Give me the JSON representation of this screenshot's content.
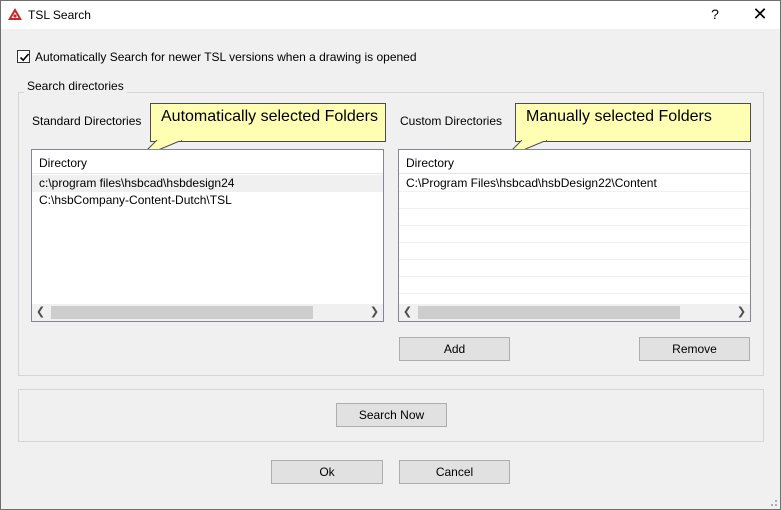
{
  "window": {
    "title": "TSL Search",
    "help_label": "?",
    "close_label": "✕",
    "app_icon": "hsbcad-logo-icon"
  },
  "auto_search": {
    "checked": true,
    "label": "Automatically Search for newer TSL versions when a drawing is opened"
  },
  "search_directories": {
    "group_title": "Search directories",
    "standard": {
      "label": "Standard Directories",
      "callout": "Automatically selected Folders",
      "column_header": "Directory",
      "rows": [
        "c:\\program files\\hsbcad\\hsbdesign24",
        "C:\\hsbCompany-Content-Dutch\\TSL"
      ]
    },
    "custom": {
      "label": "Custom Directories",
      "callout": "Manually selected Folders",
      "column_header": "Directory",
      "rows": [
        "C:\\Program Files\\hsbcad\\hsbDesign22\\Content"
      ]
    },
    "add_label": "Add",
    "remove_label": "Remove"
  },
  "search_now_label": "Search Now",
  "ok_label": "Ok",
  "cancel_label": "Cancel",
  "colors": {
    "callout_bg": "#ffffb4",
    "window_bg": "#f0f0f0",
    "button_bg": "#e1e1e1"
  }
}
